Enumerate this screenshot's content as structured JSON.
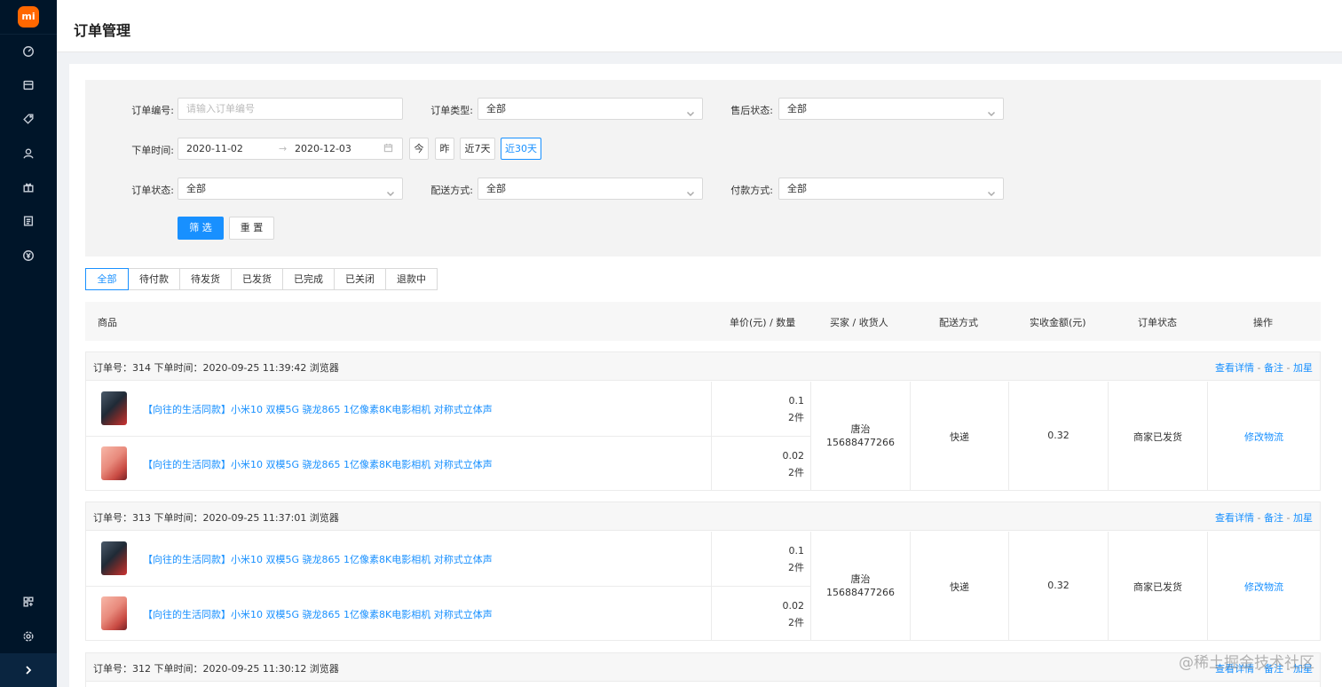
{
  "sidebar": {
    "logo": "mi",
    "nav_icons": [
      "dashboard-icon",
      "shop-icon",
      "tag-icon",
      "user-icon",
      "gift-icon",
      "order-list-icon",
      "yen-icon"
    ],
    "bottom_icons": [
      "apps-icon",
      "settings-icon"
    ],
    "collapse_icon": "chevron-right-icon"
  },
  "header": {
    "title": "订单管理"
  },
  "filters": {
    "order_no_label": "订单编号:",
    "order_no_placeholder": "请输入订单编号",
    "order_type_label": "订单类型:",
    "order_type_value": "全部",
    "aftersale_label": "售后状态:",
    "aftersale_value": "全部",
    "time_label": "下单时间:",
    "date_start": "2020-11-02",
    "date_arrow": "→",
    "date_end": "2020-12-03",
    "quick": [
      "今",
      "昨",
      "近7天",
      "近30天"
    ],
    "quick_active": 3,
    "status_label": "订单状态:",
    "status_value": "全部",
    "delivery_label": "配送方式:",
    "delivery_value": "全部",
    "payment_label": "付款方式:",
    "payment_value": "全部",
    "submit_label": "筛 选",
    "reset_label": "重 置"
  },
  "tabs": [
    "全部",
    "待付款",
    "待发货",
    "已发货",
    "已完成",
    "已关闭",
    "退款中"
  ],
  "active_tab": 0,
  "table_header": {
    "product": "商品",
    "price_qty": "单价(元) / 数量",
    "buyer": "买家 / 收货人",
    "delivery": "配送方式",
    "amount": "实收金额(元)",
    "status": "订单状态",
    "ops": "操作"
  },
  "orders": [
    {
      "meta": "订单号：314   下单时间：2020-09-25 11:39:42   浏览器",
      "view": "查看详情",
      "sep": "-",
      "note": "备注",
      "star": "加星",
      "items": [
        {
          "name": "【向往的生活同款】小米10 双模5G 骁龙865 1亿像素8K电影相机 对称式立体声",
          "price": "0.1",
          "qty": "2件"
        },
        {
          "name": "【向往的生活同款】小米10 双模5G 骁龙865 1亿像素8K电影相机 对称式立体声",
          "price": "0.02",
          "qty": "2件"
        }
      ],
      "buyer": "唐治",
      "phone": "15688477266",
      "delivery": "快递",
      "amount": "0.32",
      "status": "商家已发货",
      "op": "修改物流"
    },
    {
      "meta": "订单号：313   下单时间：2020-09-25 11:37:01   浏览器",
      "view": "查看详情",
      "sep": "-",
      "note": "备注",
      "star": "加星",
      "items": [
        {
          "name": "【向往的生活同款】小米10 双模5G 骁龙865 1亿像素8K电影相机 对称式立体声",
          "price": "0.1",
          "qty": "2件"
        },
        {
          "name": "【向往的生活同款】小米10 双模5G 骁龙865 1亿像素8K电影相机 对称式立体声",
          "price": "0.02",
          "qty": "2件"
        }
      ],
      "buyer": "唐治",
      "phone": "15688477266",
      "delivery": "快递",
      "amount": "0.32",
      "status": "商家已发货",
      "op": "修改物流"
    },
    {
      "meta": "订单号：312   下单时间：2020-09-25 11:30:12   浏览器",
      "view": "查看详情",
      "sep": "-",
      "note": "备注",
      "star": "加星"
    }
  ],
  "watermark": "@稀土掘金技术社区"
}
